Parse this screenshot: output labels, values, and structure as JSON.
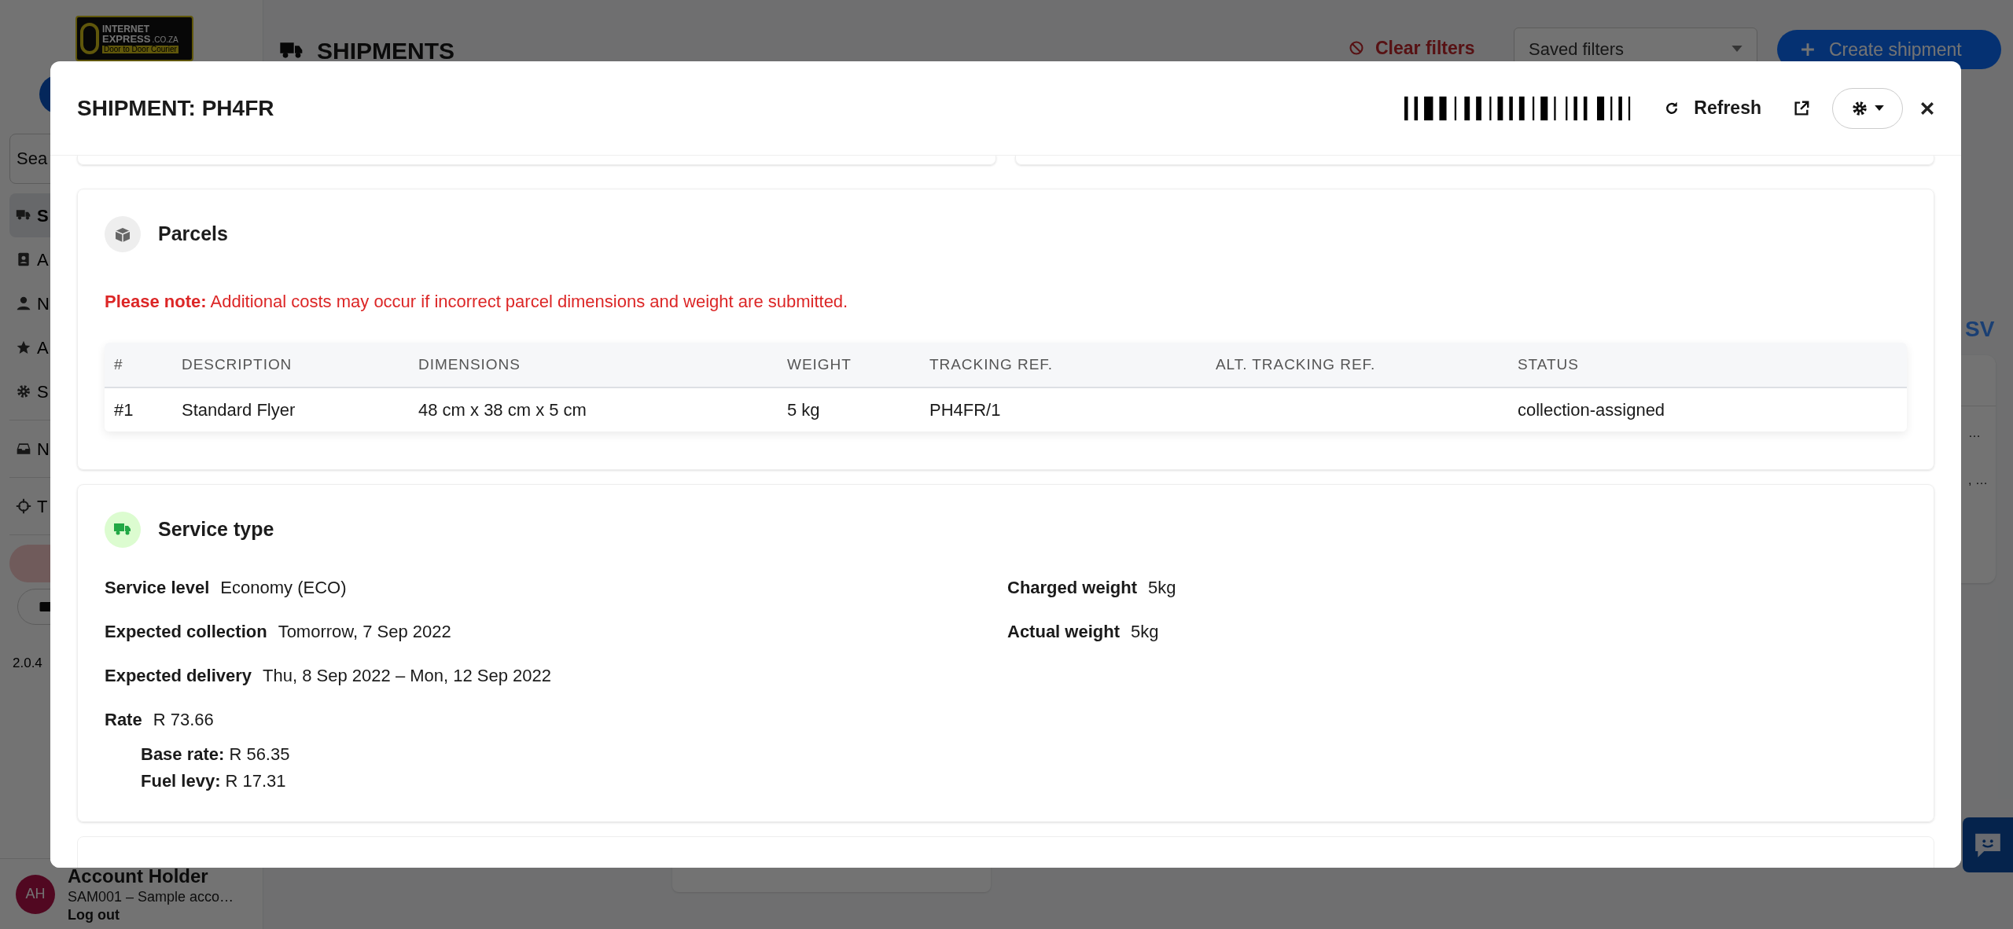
{
  "background": {
    "logo": {
      "line1": "INTERNET",
      "line2": "EXPRESS",
      "suffix": ".CO.ZA",
      "tagline": "Door to Door Courier"
    },
    "page_title": "SHIPMENTS",
    "clear_filters": "Clear filters",
    "saved_filters": {
      "placeholder": "Saved filters"
    },
    "create_button": "Create shipment",
    "sidebar": {
      "search": {
        "placeholder": "Sea"
      },
      "items": [
        {
          "label": "S",
          "selected": true
        },
        {
          "label": "A",
          "selected": false
        },
        {
          "label": "N",
          "selected": false
        },
        {
          "label": "A",
          "selected": false
        },
        {
          "label": "S",
          "selected": false
        },
        {
          "label": "N",
          "selected": false
        },
        {
          "label": "T",
          "selected": false
        }
      ],
      "version": "2.0.4"
    },
    "account": {
      "initials": "AH",
      "name": "Account Holder",
      "subtitle": "SAM001 – Sample acco…",
      "logout": "Log out"
    },
    "right_panel": {
      "link": "SV",
      "lines": [
        "…",
        ", …"
      ]
    }
  },
  "modal": {
    "title": "SHIPMENT: PH4FR",
    "refresh": "Refresh",
    "parcels": {
      "title": "Parcels",
      "note": "**Please note:** Additional costs may occur if incorrect parcel dimensions and weight are submitted.",
      "columns": [
        "#",
        "DESCRIPTION",
        "DIMENSIONS",
        "WEIGHT",
        "TRACKING REF.",
        "ALT. TRACKING REF.",
        "STATUS"
      ],
      "rows": [
        [
          "#1",
          "Standard Flyer",
          "48 cm x 38 cm x 5 cm",
          "5 kg",
          "PH4FR/1",
          "",
          "collection-assigned"
        ]
      ]
    },
    "service": {
      "title": "Service type",
      "left": [
        {
          "label": "Service level",
          "value": "Economy (ECO)"
        },
        {
          "label": "Expected collection",
          "value": "Tomorrow, 7 Sep 2022"
        },
        {
          "label": "Expected delivery",
          "value": "Thu, 8 Sep 2022 – Mon, 12 Sep 2022"
        },
        {
          "label": "Rate",
          "value": "R 73.66"
        }
      ],
      "breakdown": [
        {
          "label": "Base rate:",
          "value": "R 56.35"
        },
        {
          "label": "Fuel levy:",
          "value": "R 17.31"
        }
      ],
      "right": [
        {
          "label": "Charged weight",
          "value": "5kg"
        },
        {
          "label": "Actual weight",
          "value": "5kg"
        }
      ]
    }
  }
}
